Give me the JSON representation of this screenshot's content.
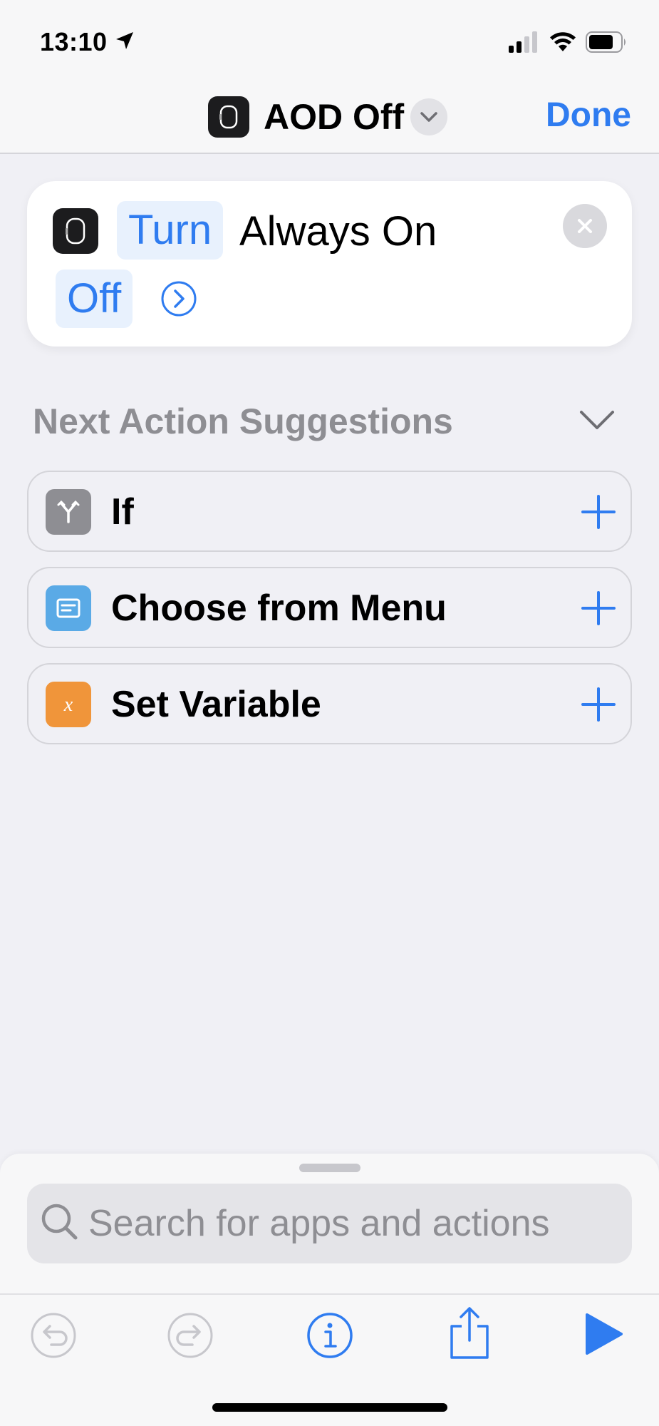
{
  "status_bar": {
    "time": "13:10"
  },
  "nav": {
    "title": "AOD Off",
    "done_label": "Done"
  },
  "action": {
    "verb": "Turn",
    "text": "Always On",
    "state": "Off"
  },
  "suggestions": {
    "header": "Next Action Suggestions",
    "items": [
      {
        "label": "If",
        "icon": "branch-icon",
        "icon_color": "#8e8e93"
      },
      {
        "label": "Choose from Menu",
        "icon": "menu-icon",
        "icon_color": "#5aaae6"
      },
      {
        "label": "Set Variable",
        "icon": "variable-icon",
        "icon_color": "#f0953a"
      }
    ]
  },
  "search": {
    "placeholder": "Search for apps and actions"
  },
  "colors": {
    "accent": "#2f7cf0",
    "background": "#f0f0f5"
  }
}
